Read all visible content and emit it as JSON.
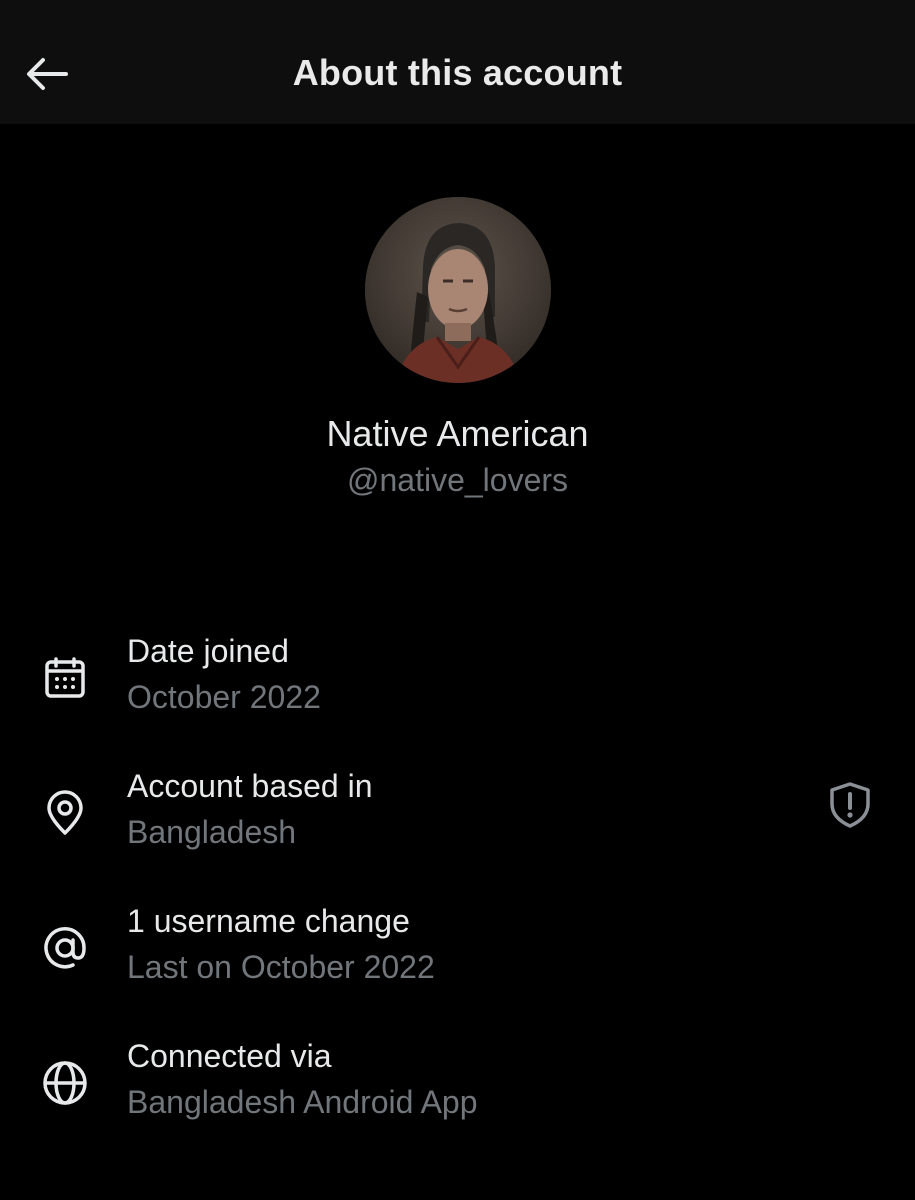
{
  "header": {
    "title": "About this account",
    "back_icon": "arrow-left-icon"
  },
  "profile": {
    "display_name": "Native American",
    "handle": "@native_lovers",
    "avatar_icon": "profile-photo"
  },
  "details": [
    {
      "icon": "calendar-icon",
      "label": "Date joined",
      "value": "October 2022"
    },
    {
      "icon": "location-pin-icon",
      "label": "Account based in",
      "value": "Bangladesh",
      "badge_icon": "shield-alert-icon"
    },
    {
      "icon": "at-sign-icon",
      "label": "1 username change",
      "value": "Last on October 2022"
    },
    {
      "icon": "globe-icon",
      "label": "Connected via",
      "value": "Bangladesh Android App"
    }
  ],
  "colors": {
    "background": "#000000",
    "header_background": "#0e0e0e",
    "primary_text": "#e7e9ea",
    "secondary_text": "#71767b"
  }
}
